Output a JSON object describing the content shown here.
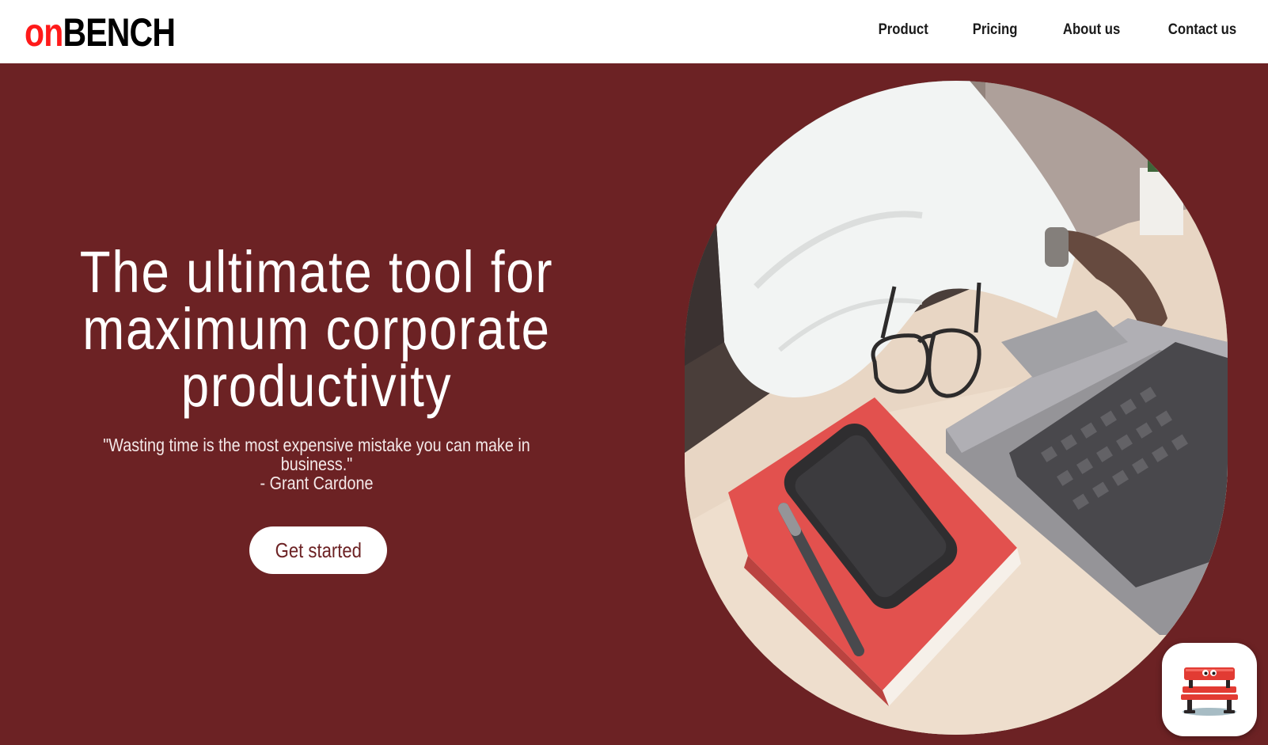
{
  "brand": {
    "logo_prefix": "on",
    "logo_suffix": "BENCH",
    "accent_color": "#ff1a1a",
    "hero_background": "#6c2224"
  },
  "nav": {
    "items": [
      {
        "label": "Product"
      },
      {
        "label": "Pricing"
      },
      {
        "label": "About us"
      },
      {
        "label": "Contact us"
      }
    ]
  },
  "hero": {
    "headline_line1": "The ultimate tool for",
    "headline_line2": "maximum corporate",
    "headline_line3": "productivity",
    "quote_text": "\"Wasting time is the most expensive mistake you can make in business.\"",
    "quote_author": "- Grant Cardone",
    "cta_label": "Get started",
    "image_icon": "desk-laptop-notebook-photo"
  },
  "widget": {
    "icon": "bench-mascot-icon"
  }
}
